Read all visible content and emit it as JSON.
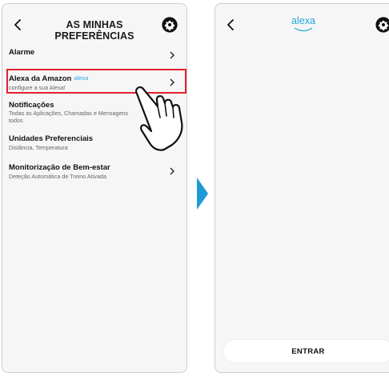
{
  "left_screen": {
    "title": "AS MINHAS PREFERÊNCIAS",
    "items": [
      {
        "label": "Alarme",
        "sub": ""
      },
      {
        "label": "Alexa da Amazon",
        "badge": "alexa",
        "sub": "configure a sua Alexa!"
      },
      {
        "label": "Notificações",
        "sub": "Todas as Aplicações, Chamadas e Mensagens",
        "sub2": "todos"
      },
      {
        "label": "Unidades Preferenciais",
        "sub": "Distância, Temperatura"
      },
      {
        "label": "Monitorização de Bem-estar",
        "sub": "Deteção Automática de Treino Ativada"
      }
    ]
  },
  "right_screen": {
    "logo_text": "alexa",
    "button_label": "ENTRAR"
  },
  "colors": {
    "highlight": "#e5202e",
    "accent_blue": "#22a7db",
    "screen_bg": "#f6f6f6"
  },
  "icons": [
    "back-chevron-icon",
    "gear-icon",
    "chevron-right-icon",
    "hand-pointer-icon",
    "arrow-right-icon"
  ]
}
